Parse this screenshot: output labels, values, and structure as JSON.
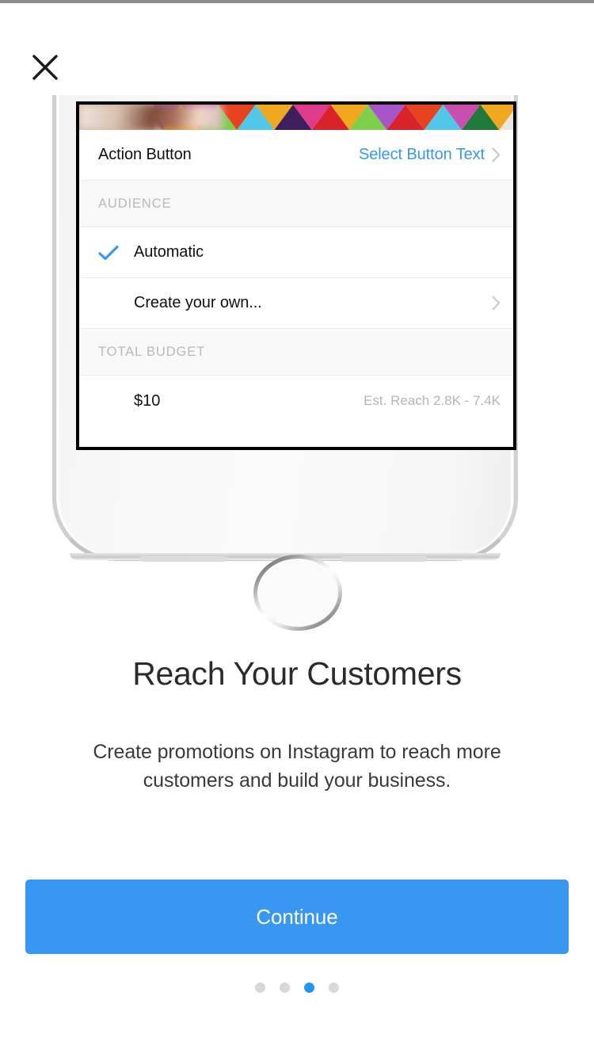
{
  "screen": {
    "title": "Reach Your Customers",
    "description": "Create promotions on Instagram to reach more customers and build your business.",
    "close_icon": "close-icon"
  },
  "accent_colors": {
    "brand_blue": "#3897F0",
    "dot_active": "#2196F3",
    "muted_text": "#B9B9B9",
    "body_text": "#3A3A3A"
  },
  "phone_preview": {
    "rows": [
      {
        "type": "link-row",
        "label": "Action Button",
        "value": "Select Button Text",
        "chevron": true
      }
    ],
    "audience_section": {
      "header": "AUDIENCE",
      "options": [
        {
          "label": "Automatic",
          "checked": true,
          "chevron": false
        },
        {
          "label": "Create your own...",
          "checked": false,
          "chevron": true
        }
      ]
    },
    "budget_section": {
      "header": "TOTAL BUDGET",
      "amount": "$10",
      "reach": "Est. Reach 2.8K - 7.4K"
    }
  },
  "cta": {
    "label": "Continue"
  },
  "pagination": {
    "total": 4,
    "active_index": 2
  }
}
